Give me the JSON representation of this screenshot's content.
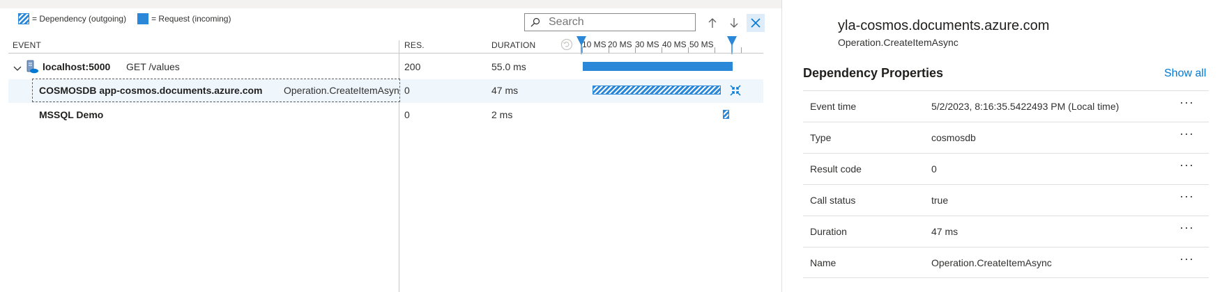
{
  "legend": {
    "dependency_label": "= Dependency (outgoing)",
    "request_label": "= Request (incoming)"
  },
  "toolbar": {
    "search_placeholder": "Search",
    "icons": [
      "search-icon",
      "arrow-up-icon",
      "arrow-down-icon",
      "close-icon"
    ]
  },
  "columns": {
    "event": "EVENT",
    "result": "RES.",
    "duration": "DURATION"
  },
  "timeline": {
    "ticks": [
      "10 MS",
      "20 MS",
      "30 MS",
      "40 MS",
      "50 MS"
    ],
    "bar_color": "#2b88d8"
  },
  "rows": [
    {
      "name": "localhost:5000",
      "detail": "GET /values",
      "result": "200",
      "duration": "55.0 ms",
      "kind": "request"
    },
    {
      "name": "COSMOSDB app-cosmos.documents.azure.com",
      "detail": "Operation.CreateItemAsync",
      "result": "0",
      "duration": "47 ms",
      "kind": "dependency",
      "selected": true
    },
    {
      "name": "MSSQL Demo",
      "detail": "",
      "result": "0",
      "duration": "2 ms",
      "kind": "dependency"
    }
  ],
  "details": {
    "title": "yla-cosmos.documents.azure.com",
    "subtitle": "Operation.CreateItemAsync",
    "section_title": "Dependency Properties",
    "show_all": "Show all",
    "more_label": "···",
    "properties": [
      {
        "key": "Event time",
        "value": "5/2/2023, 8:16:35.5422493 PM (Local time)"
      },
      {
        "key": "Type",
        "value": "cosmosdb"
      },
      {
        "key": "Result code",
        "value": "0"
      },
      {
        "key": "Call status",
        "value": "true"
      },
      {
        "key": "Duration",
        "value": "47 ms"
      },
      {
        "key": "Name",
        "value": "Operation.CreateItemAsync"
      }
    ]
  },
  "colors": {
    "accent": "#0078d4",
    "bar": "#2b88d8",
    "selected_row": "#eff6fc"
  }
}
